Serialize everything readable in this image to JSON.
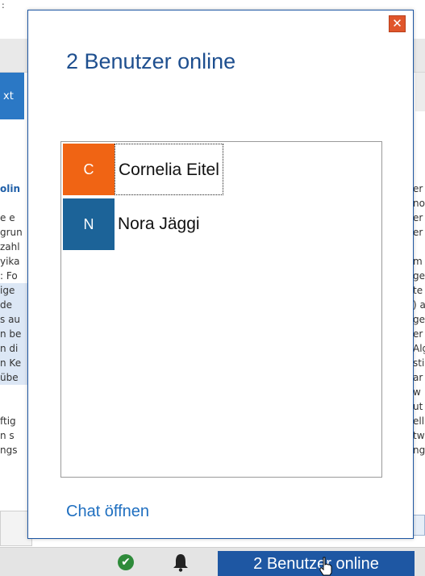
{
  "background": {
    "corner_text": ":",
    "tab_label": "xt",
    "left_lines": [
      {
        "text": "olin",
        "style": "blue"
      },
      {
        "text": "",
        "style": ""
      },
      {
        "text": "e e",
        "style": ""
      },
      {
        "text": "grun",
        "style": ""
      },
      {
        "text": "zahl",
        "style": ""
      },
      {
        "text": "yika",
        "style": ""
      },
      {
        "text": ": Fo",
        "style": ""
      },
      {
        "text": "ige",
        "style": "hl"
      },
      {
        "text": "de",
        "style": "hl"
      },
      {
        "text": "s au",
        "style": "hl"
      },
      {
        "text": "n be",
        "style": "hl"
      },
      {
        "text": "n di",
        "style": "hl"
      },
      {
        "text": "n Ke",
        "style": "hl"
      },
      {
        "text": " übe",
        "style": "hl"
      },
      {
        "text": "",
        "style": ""
      },
      {
        "text": "",
        "style": ""
      },
      {
        "text": "ftig",
        "style": ""
      },
      {
        "text": "n s",
        "style": ""
      },
      {
        "text": "ngs",
        "style": ""
      }
    ],
    "right_lines": [
      "er",
      "no",
      "er",
      "er",
      "",
      "m",
      "ge",
      "te",
      ") a",
      "ge",
      "er",
      "Alg",
      "sti",
      "ar",
      " w",
      "ut",
      "ell",
      "tw",
      "ng"
    ]
  },
  "popup": {
    "title": "2 Benutzer online",
    "close_symbol": "✕",
    "users": [
      {
        "initial": "C",
        "name": "Cornelia Eitel",
        "color": "#f06414",
        "selected": true
      },
      {
        "initial": "N",
        "name": "Nora Jäggi",
        "color": "#1c6398",
        "selected": false
      }
    ],
    "chat_link": "Chat öffnen"
  },
  "statusbar": {
    "check_symbol": "✔",
    "online_button": "2 Benutzer online"
  },
  "colors": {
    "accent": "#1e57a3",
    "link": "#1f6fc0",
    "close": "#e0562b"
  }
}
